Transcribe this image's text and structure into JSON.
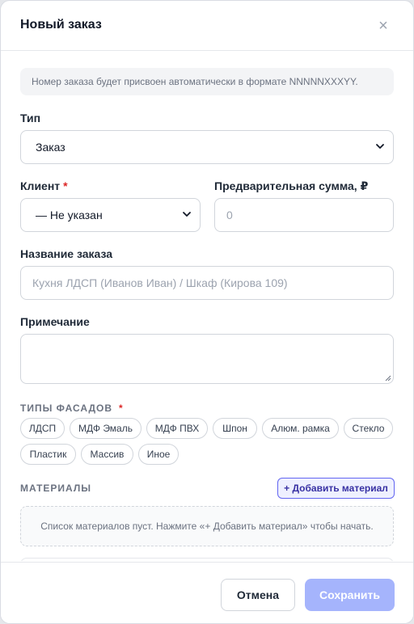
{
  "modal": {
    "title": "Новый заказ",
    "close_glyph": "×"
  },
  "form": {
    "info_text": "Номер заказа будет присвоен автоматически в формате NNNNNXXXYY.",
    "type": {
      "label": "Тип",
      "value": "Заказ"
    },
    "client": {
      "label": "Клиент",
      "required_mark": "*",
      "value": "— Не указан"
    },
    "estimate": {
      "label": "Предварительная сумма, ₽",
      "placeholder": "0"
    },
    "order_name": {
      "label": "Название заказа",
      "placeholder": "Кухня ЛДСП (Иванов Иван) / Шкаф (Кирова 109)"
    },
    "note": {
      "label": "Примечание",
      "value": ""
    },
    "facades": {
      "label": "ТИПЫ ФАСАДОВ",
      "required_mark": "*",
      "chips": [
        "ЛДСП",
        "МДФ Эмаль",
        "МДФ ПВХ",
        "Шпон",
        "Алюм. рамка",
        "Стекло",
        "Пластик",
        "Массив",
        "Иное"
      ]
    },
    "materials": {
      "label": "МАТЕРИАЛЫ",
      "add_button": "+ Добавить материал",
      "empty_text": "Список материалов пуст. Нажмите «+ Добавить материал» чтобы начать."
    }
  },
  "footer": {
    "cancel": "Отмена",
    "save": "Сохранить"
  },
  "colors": {
    "accent": "#6366f1",
    "save_button": "#a5b4fc",
    "required": "#dc2626"
  }
}
